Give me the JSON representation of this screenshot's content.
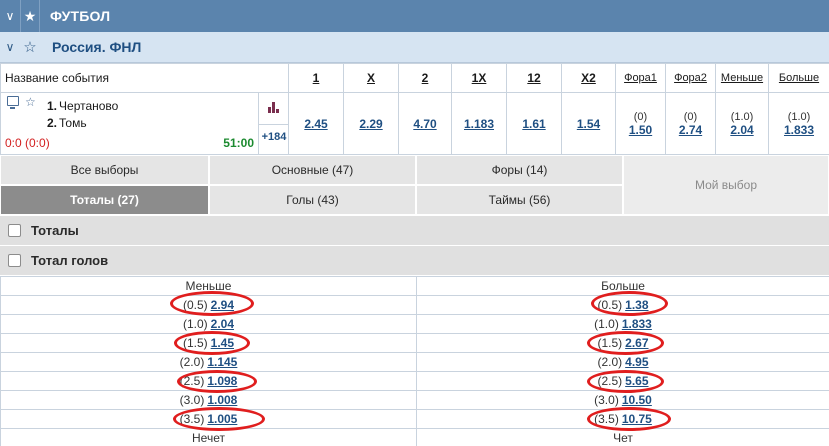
{
  "sport": {
    "title": "ФУТБОЛ"
  },
  "league": {
    "title": "Россия. ФНЛ"
  },
  "odds_header": {
    "event_name_label": "Название события",
    "columns": [
      "1",
      "X",
      "2",
      "1X",
      "12",
      "X2",
      "Фора1",
      "Фора2",
      "Меньше",
      "Больше"
    ]
  },
  "event": {
    "team1_num": "1.",
    "team1": "Чертаново",
    "team2_num": "2.",
    "team2": "Томь",
    "score": "0:0 (0:0)",
    "time": "51:00",
    "more_markets": "+184",
    "odds": {
      "w1": "2.45",
      "x": "2.29",
      "w2": "4.70",
      "x1": "1.183",
      "x12": "1.61",
      "x2": "1.54",
      "f1_param": "(0)",
      "f1": "1.50",
      "f2_param": "(0)",
      "f2": "2.74",
      "under_param": "(1.0)",
      "under": "2.04",
      "over_param": "(1.0)",
      "over": "1.833"
    }
  },
  "tabs": {
    "all": "Все выборы",
    "main": "Основные (47)",
    "handicaps": "Форы (14)",
    "totals": "Тоталы (27)",
    "goals": "Голы (43)",
    "halves": "Таймы (56)",
    "my_choice": "Мой выбор"
  },
  "sections": {
    "totals": "Тоталы",
    "total_goals": "Тотал голов"
  },
  "total_goals": {
    "under_label": "Меньше",
    "over_label": "Больше",
    "rows": [
      {
        "u_param": "(0.5)",
        "u_val": "2.94",
        "o_param": "(0.5)",
        "o_val": "1.38"
      },
      {
        "u_param": "(1.0)",
        "u_val": "2.04",
        "o_param": "(1.0)",
        "o_val": "1.833"
      },
      {
        "u_param": "(1.5)",
        "u_val": "1.45",
        "o_param": "(1.5)",
        "o_val": "2.67"
      },
      {
        "u_param": "(2.0)",
        "u_val": "1.145",
        "o_param": "(2.0)",
        "o_val": "4.95"
      },
      {
        "u_param": "(2.5)",
        "u_val": "1.098",
        "o_param": "(2.5)",
        "o_val": "5.65"
      },
      {
        "u_param": "(3.0)",
        "u_val": "1.008",
        "o_param": "(3.0)",
        "o_val": "10.50"
      },
      {
        "u_param": "(3.5)",
        "u_val": "1.005",
        "o_param": "(3.5)",
        "o_val": "10.75"
      }
    ],
    "odd_label": "Нечет",
    "even_label": "Чет"
  },
  "colors": {
    "sport_bar": "#5b84ad",
    "league_bar": "#d6e4f2",
    "link": "#1f4f82",
    "score": "#d32020",
    "time": "#1b8a2f",
    "highlight_circle": "#e01e1e",
    "active_tab": "#8c8c8c"
  },
  "icons": [
    "chevron-down-icon",
    "star-icon",
    "monitor-icon",
    "bar-chart-icon",
    "checkbox-icon"
  ]
}
